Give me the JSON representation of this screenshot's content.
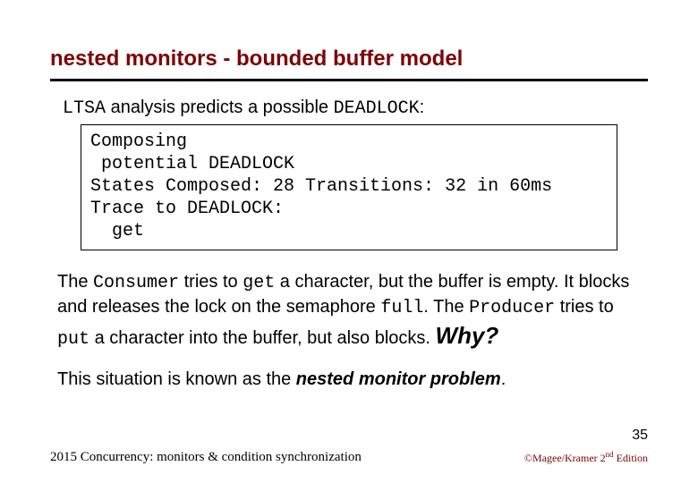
{
  "title": "nested monitors -  bounded buffer model",
  "intro": {
    "ltsa": "LTSA",
    "mid": " analysis predicts a possible ",
    "deadlock": "DEADLOCK",
    "tail": ":"
  },
  "codebox": "Composing\n potential DEADLOCK\nStates Composed: 28 Transitions: 32 in 60ms\nTrace to DEADLOCK:\n  get",
  "para1": {
    "t1": "The ",
    "consumer": "Consumer",
    "t2": " tries to ",
    "get": "get",
    "t3": " a character, but the buffer is empty. It blocks and releases the lock on the semaphore ",
    "full": "full",
    "t4": ". The ",
    "producer": "Producer",
    "t5": " tries to ",
    "put": "put",
    "t6": " a character into the buffer, but also blocks. ",
    "why": "Why?"
  },
  "para2": {
    "t1": "This situation is known as the ",
    "term": "nested monitor problem",
    "t2": "."
  },
  "pagenum": "35",
  "footer_left": "2015  Concurrency: monitors & condition synchronization",
  "footer_right": {
    "pre": "©Magee/Kramer ",
    "ed_num": "2",
    "ed_sup": "nd",
    "ed_tail": " Edition"
  }
}
